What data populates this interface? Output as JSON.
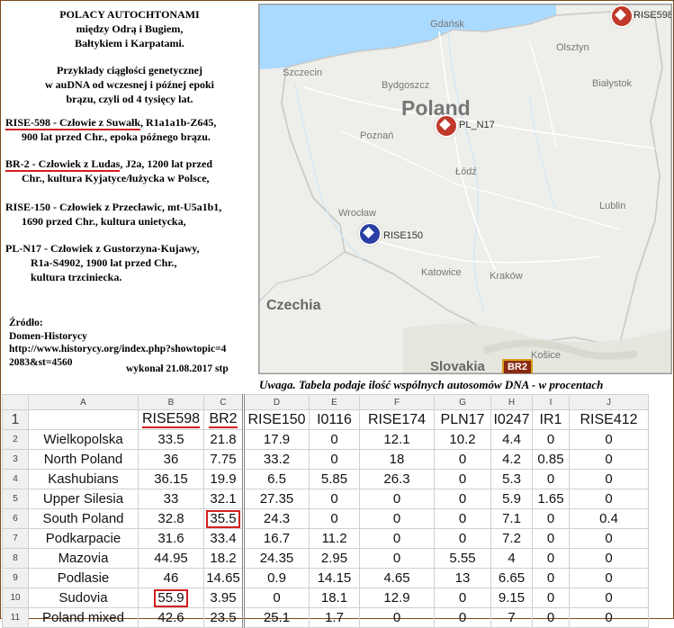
{
  "info": {
    "title": [
      "POLACY AUTOCHTONAMI",
      "między Odrą i Bugiem,",
      "Bałtykiem  i Karpatami."
    ],
    "intro": [
      "Przykłady ciągłości genetycznej",
      "w  auDNA od  wczesnej i późnej epoki",
      "brązu, czyli od 4 tysięcy lat."
    ],
    "entries": [
      {
        "head": "RISE-598 - Człowie z Suwałk",
        "rest": ", R1a1a1b-Z645,",
        "line2": "900 lat przed Chr.,  epoka późnego brązu."
      },
      {
        "head": "BR-2 - Człowiek z Ludas",
        "rest": ", J2a, 1200 lat przed",
        "line2": "Chr., kultura Kyjatyce/łużycka w Polsce,"
      },
      {
        "head": "RISE-150 - Człowiek z Przecławic, mt-U5a1b1,",
        "rest": "",
        "line2": "1690 przed Chr.,  kultura unietycka,"
      },
      {
        "head": "PL-N17 -  Człowiek z  Gustorzyna-Kujawy,",
        "rest": "",
        "line2": "R1a-S4902, 1900 lat przed Chr.,",
        "line3": "kultura trzciniecka."
      }
    ],
    "source": [
      "Źródło:",
      "Domen-Historycy",
      "http://www.historycy.org/index.php?showtopic=4",
      "2083&st=4560"
    ],
    "signature": "wykonał 21.08.2017 stp"
  },
  "map": {
    "country_poland": "Poland",
    "country_czech": "Czechia",
    "country_slovakia": "Slovakia",
    "cities": {
      "gdansk": "Gdańsk",
      "olsztyn": "Olsztyn",
      "szczecin": "Szczecin",
      "bialystok": "Białystok",
      "bydgoszcz": "Bydgoszcz",
      "poznan": "Poznań",
      "lodz": "Łódź",
      "lublin": "Lublin",
      "wroclaw": "Wrocław",
      "katowice": "Katowice",
      "krakow": "Kraków",
      "kosice": "Košice"
    },
    "markers": {
      "rise598": "RISE598",
      "pln17": "PL_N17",
      "rise150": "RISE150",
      "br2": "BR2"
    },
    "colors": {
      "red_marker": "#c0392b",
      "blue_marker": "#2a3fa3",
      "br2_fill": "#8a2a12",
      "br2_border": "#d4a21a"
    }
  },
  "note": "Uwaga. Tabela podaje ilość wspólnych autosomów DNA - w procentach",
  "sheet": {
    "col_letters": [
      "A",
      "B",
      "C",
      "D",
      "E",
      "F",
      "G",
      "H",
      "I",
      "J"
    ],
    "headers": [
      "",
      "RISE598",
      "BR2",
      "RISE150",
      "I0116",
      "RISE174",
      "PLN17",
      "I0247",
      "IR1",
      "RISE412"
    ],
    "rows": [
      [
        "Wielkopolska",
        "33.5",
        "21.8",
        "17.9",
        "0",
        "12.1",
        "10.2",
        "4.4",
        "0",
        "0"
      ],
      [
        "North Poland",
        "36",
        "7.75",
        "33.2",
        "0",
        "18",
        "0",
        "4.2",
        "0.85",
        "0"
      ],
      [
        "Kashubians",
        "36.15",
        "19.9",
        "6.5",
        "5.85",
        "26.3",
        "0",
        "5.3",
        "0",
        "0"
      ],
      [
        "Upper Silesia",
        "33",
        "32.1",
        "27.35",
        "0",
        "0",
        "0",
        "5.9",
        "1.65",
        "0"
      ],
      [
        "South Poland",
        "32.8",
        "35.5",
        "24.3",
        "0",
        "0",
        "0",
        "7.1",
        "0",
        "0.4"
      ],
      [
        "Podkarpacie",
        "31.6",
        "33.4",
        "16.7",
        "11.2",
        "0",
        "0",
        "7.2",
        "0",
        "0"
      ],
      [
        "Mazovia",
        "44.95",
        "18.2",
        "24.35",
        "2.95",
        "0",
        "5.55",
        "4",
        "0",
        "0"
      ],
      [
        "Podlasie",
        "46",
        "14.65",
        "0.9",
        "14.15",
        "4.65",
        "13",
        "6.65",
        "0",
        "0"
      ],
      [
        "Sudovia",
        "55.9",
        "3.95",
        "0",
        "18.1",
        "12.9",
        "0",
        "9.15",
        "0",
        "0"
      ],
      [
        "Poland mixed",
        "42.6",
        "23.5",
        "25.1",
        "1.7",
        "0",
        "0",
        "7",
        "0",
        "0"
      ]
    ]
  }
}
